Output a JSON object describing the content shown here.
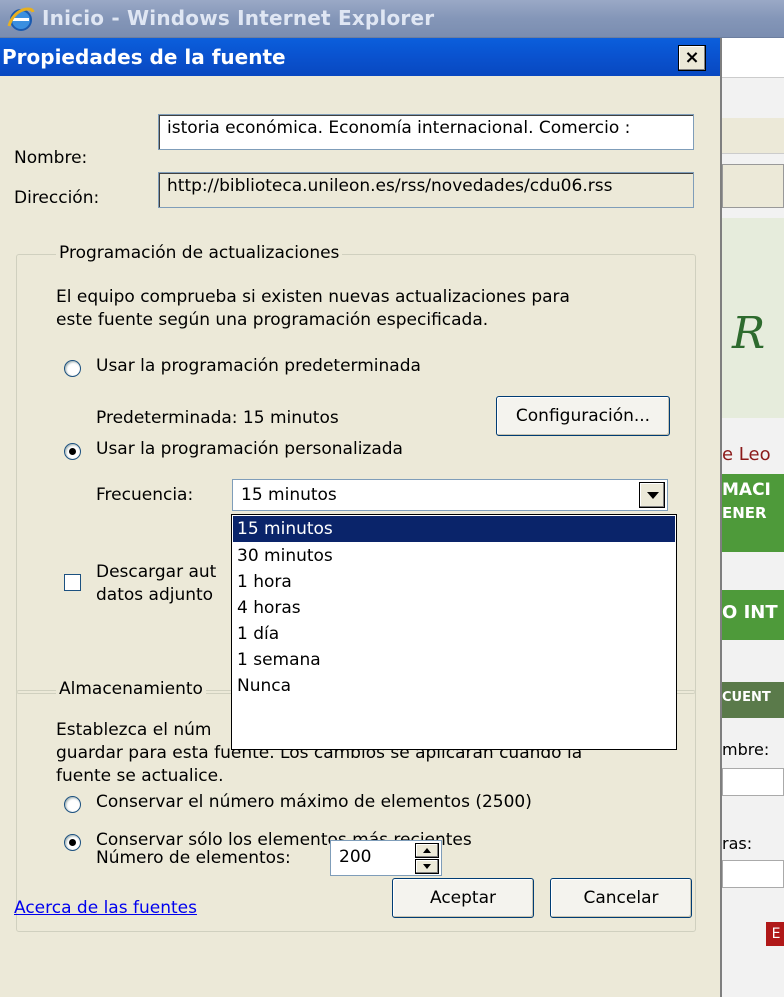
{
  "browser": {
    "title": "Inicio - Windows Internet Explorer"
  },
  "dialog": {
    "title": "Propiedades de la fuente",
    "close_symbol": "×",
    "name_label": "Nombre:",
    "name_value": "istoria económica. Economía internacional. Comercio :",
    "address_label": "Dirección:",
    "address_value": "http://biblioteca.unileon.es/rss/novedades/cdu06.rss"
  },
  "schedule": {
    "legend": "Programación de actualizaciones",
    "description_line1": "El equipo comprueba si existen nuevas actualizaciones para",
    "description_line2": "este fuente según una programación especificada.",
    "default_option": "Usar la programación predeterminada",
    "default_info": "Predeterminada: 15 minutos",
    "settings_button": "Configuración...",
    "custom_option": "Usar la programación personalizada",
    "frequency_label": "Frecuencia:",
    "frequency_value": "15 minutos",
    "frequency_options": [
      "15 minutos",
      "30 minutos",
      "1 hora",
      "4 horas",
      "1 día",
      "1 semana",
      "Nunca"
    ],
    "download_line1": "Descargar aut",
    "download_line2": "datos adjunto"
  },
  "storage": {
    "legend": "Almacenamiento",
    "description_line1": "Establezca el núm",
    "description_line2": "guardar para esta fuente. Los cambios se aplicarán cuando la",
    "description_line3": "fuente se actualice.",
    "keep_max_option": "Conservar el número máximo de elementos (2500)",
    "keep_recent_option": "Conservar sólo los elementos más recientes",
    "item_count_label": "Número de elementos:",
    "item_count_value": "200"
  },
  "footer": {
    "about_link": "Acerca de las fuentes",
    "ok_button": "Aceptar",
    "cancel_button": "Cancelar"
  },
  "background_page": {
    "logo_fragment": "R",
    "text_1": "e Leo",
    "text_2a": "MACI",
    "text_2b": "ENER",
    "text_3": "O INT",
    "text_4": "CUENT",
    "text_5": "mbre:",
    "text_6": "ras:",
    "text_7": "E"
  },
  "colors": {
    "dialog_bg": "#ece9d8",
    "titlebar_blue": "#0a53d0",
    "selection": "#0a246a",
    "bg_green": "#4e9a3a"
  }
}
